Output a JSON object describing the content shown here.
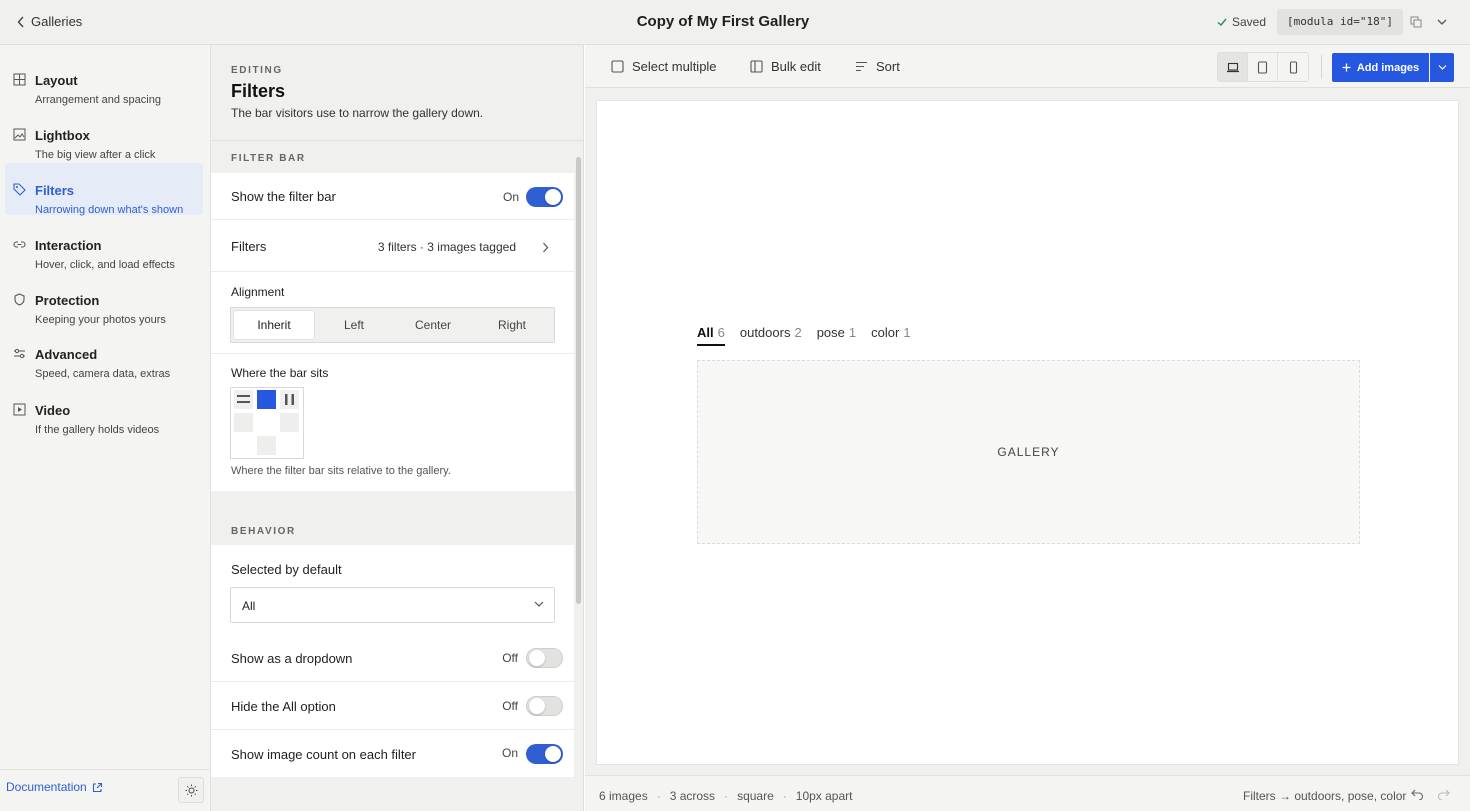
{
  "header": {
    "back_label": "Galleries",
    "title": "Copy of My First Gallery",
    "saved_label": "Saved",
    "shortcode": "[modula id=\"18\"]"
  },
  "nav": {
    "items": [
      {
        "label": "Layout",
        "sub": "Arrangement and spacing",
        "icon": "grid-icon"
      },
      {
        "label": "Lightbox",
        "sub": "The big view after a click",
        "icon": "image-icon"
      },
      {
        "label": "Filters",
        "sub": "Narrowing down what's shown",
        "icon": "tag-icon"
      },
      {
        "label": "Interaction",
        "sub": "Hover, click, and load effects",
        "icon": "link-icon"
      },
      {
        "label": "Protection",
        "sub": "Keeping your photos yours",
        "icon": "shield-icon"
      },
      {
        "label": "Advanced",
        "sub": "Speed, camera data, extras",
        "icon": "sliders-icon"
      },
      {
        "label": "Video",
        "sub": "If the gallery holds videos",
        "icon": "play-icon"
      }
    ],
    "active": "Filters",
    "documentation_label": "Documentation"
  },
  "panel": {
    "eyebrow": "EDITING",
    "title": "Filters",
    "description": "The bar visitors use to narrow the gallery down.",
    "filter_bar_section": "FILTER BAR",
    "show_filter_bar": {
      "label": "Show the filter bar",
      "state": "On"
    },
    "filters_row": {
      "label": "Filters",
      "value": "3 filters · 3 images tagged"
    },
    "alignment": {
      "label": "Alignment",
      "options": [
        "Inherit",
        "Left",
        "Center",
        "Right"
      ],
      "selected": "Inherit"
    },
    "position": {
      "label": "Where the bar sits",
      "hint": "Where the filter bar sits relative to the gallery."
    },
    "behavior_section": "BEHAVIOR",
    "selected_default": {
      "label": "Selected by default",
      "value": "All"
    },
    "show_dropdown": {
      "label": "Show as a dropdown",
      "state": "Off"
    },
    "hide_all": {
      "label": "Hide the All option",
      "state": "Off"
    },
    "show_count": {
      "label": "Show image count on each filter",
      "state": "On"
    }
  },
  "toolbar": {
    "select_multiple": "Select multiple",
    "bulk_edit": "Bulk edit",
    "sort": "Sort",
    "add_images": "Add images"
  },
  "preview": {
    "filters": [
      {
        "name": "All",
        "count": "6"
      },
      {
        "name": "outdoors",
        "count": "2"
      },
      {
        "name": "pose",
        "count": "1"
      },
      {
        "name": "color",
        "count": "1"
      }
    ],
    "gallery_placeholder": "GALLERY"
  },
  "status": {
    "images": "6 images",
    "across": "3 across",
    "shape": "square",
    "spacing": "10px apart",
    "summary": "Filters → outdoors, pose, color"
  },
  "colors": {
    "accent": "#2557e0",
    "active_nav_bg": "#e6ebf8"
  }
}
